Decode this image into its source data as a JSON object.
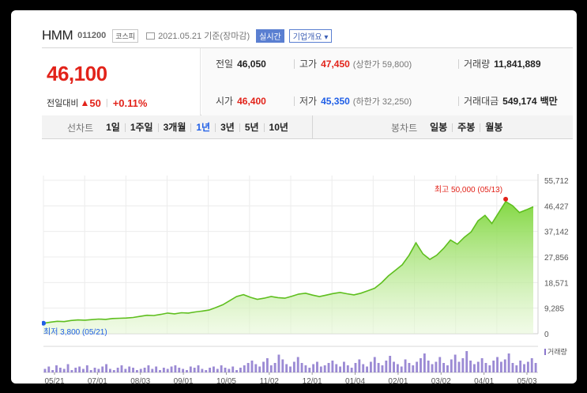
{
  "header": {
    "name": "HMM",
    "code": "011200",
    "market": "코스피",
    "date": "2021.05.21",
    "basis": "기준(장마감)",
    "realtime": "실시간",
    "corp_info": "기업개요"
  },
  "quote": {
    "price": "46,100",
    "change_label": "전일대비",
    "change_amount": "50",
    "change_pct": "+0.11%",
    "prev_close_label": "전일",
    "prev_close": "46,050",
    "high_label": "고가",
    "high": "47,450",
    "upper_limit": "(상한가 59,800)",
    "volume_label": "거래량",
    "volume": "11,841,889",
    "open_label": "시가",
    "open": "46,400",
    "low_label": "저가",
    "low": "45,350",
    "lower_limit": "(하한가 32,250)",
    "value_label": "거래대금",
    "value": "549,174",
    "value_unit": "백만"
  },
  "tabs": {
    "line_label": "선차트",
    "line_items": [
      "1일",
      "1주일",
      "3개월",
      "1년",
      "3년",
      "5년",
      "10년"
    ],
    "active": "1년",
    "candle_label": "봉차트",
    "candle_items": [
      "일봉",
      "주봉",
      "월봉"
    ]
  },
  "colors": {
    "up": "#e2231a",
    "down": "#1f5ee6",
    "line": "#5fbf1f",
    "volume": "#8a75cc"
  },
  "chart_data": {
    "type": "area",
    "x_ticks": [
      "05/21",
      "07/01",
      "08/03",
      "09/01",
      "10/05",
      "11/02",
      "12/01",
      "01/04",
      "02/01",
      "03/02",
      "04/01",
      "05/03"
    ],
    "y_ticks": [
      "55,712",
      "46,427",
      "37,142",
      "27,856",
      "18,571",
      "9,285",
      "0"
    ],
    "ylim": [
      0,
      55712
    ],
    "high_label": "최고 50,000 (05/13)",
    "low_label": "최저 3,800 (05/21)",
    "volume_label": "거래량",
    "price_series": [
      3800,
      4200,
      4500,
      4400,
      4800,
      5000,
      4900,
      5100,
      5300,
      5200,
      5500,
      5600,
      5700,
      5900,
      6300,
      6700,
      6600,
      7000,
      7500,
      7200,
      7600,
      7500,
      7900,
      8200,
      8600,
      9500,
      10500,
      12000,
      13500,
      14200,
      13200,
      12500,
      12900,
      13500,
      13100,
      12900,
      13600,
      14400,
      14700,
      14000,
      13500,
      14000,
      14600,
      15000,
      14500,
      14100,
      14700,
      15600,
      16500,
      18500,
      21000,
      23000,
      25000,
      28500,
      33000,
      29000,
      27000,
      28500,
      31000,
      34000,
      32500,
      35000,
      37000,
      41000,
      43000,
      40000,
      44000,
      48000,
      46500,
      44000,
      45000,
      46100
    ],
    "volume_series": [
      3,
      5,
      2,
      6,
      4,
      3,
      7,
      2,
      4,
      5,
      3,
      6,
      2,
      4,
      3,
      5,
      7,
      3,
      2,
      4,
      6,
      3,
      5,
      4,
      2,
      3,
      4,
      6,
      3,
      5,
      2,
      4,
      3,
      5,
      6,
      4,
      3,
      2,
      5,
      4,
      6,
      3,
      2,
      4,
      5,
      3,
      6,
      4,
      3,
      5,
      2,
      4,
      6,
      8,
      10,
      7,
      5,
      9,
      12,
      6,
      8,
      15,
      11,
      7,
      5,
      9,
      13,
      8,
      6,
      4,
      7,
      9,
      5,
      6,
      8,
      10,
      7,
      5,
      9,
      6,
      4,
      8,
      11,
      7,
      5,
      9,
      13,
      8,
      6,
      10,
      14,
      9,
      7,
      5,
      11,
      8,
      6,
      9,
      12,
      16,
      10,
      7,
      9,
      13,
      8,
      6,
      11,
      15,
      9,
      12,
      18,
      10,
      7,
      9,
      12,
      8,
      6,
      10,
      13,
      9,
      11,
      16,
      8,
      6,
      10,
      7,
      9,
      12,
      8
    ]
  }
}
